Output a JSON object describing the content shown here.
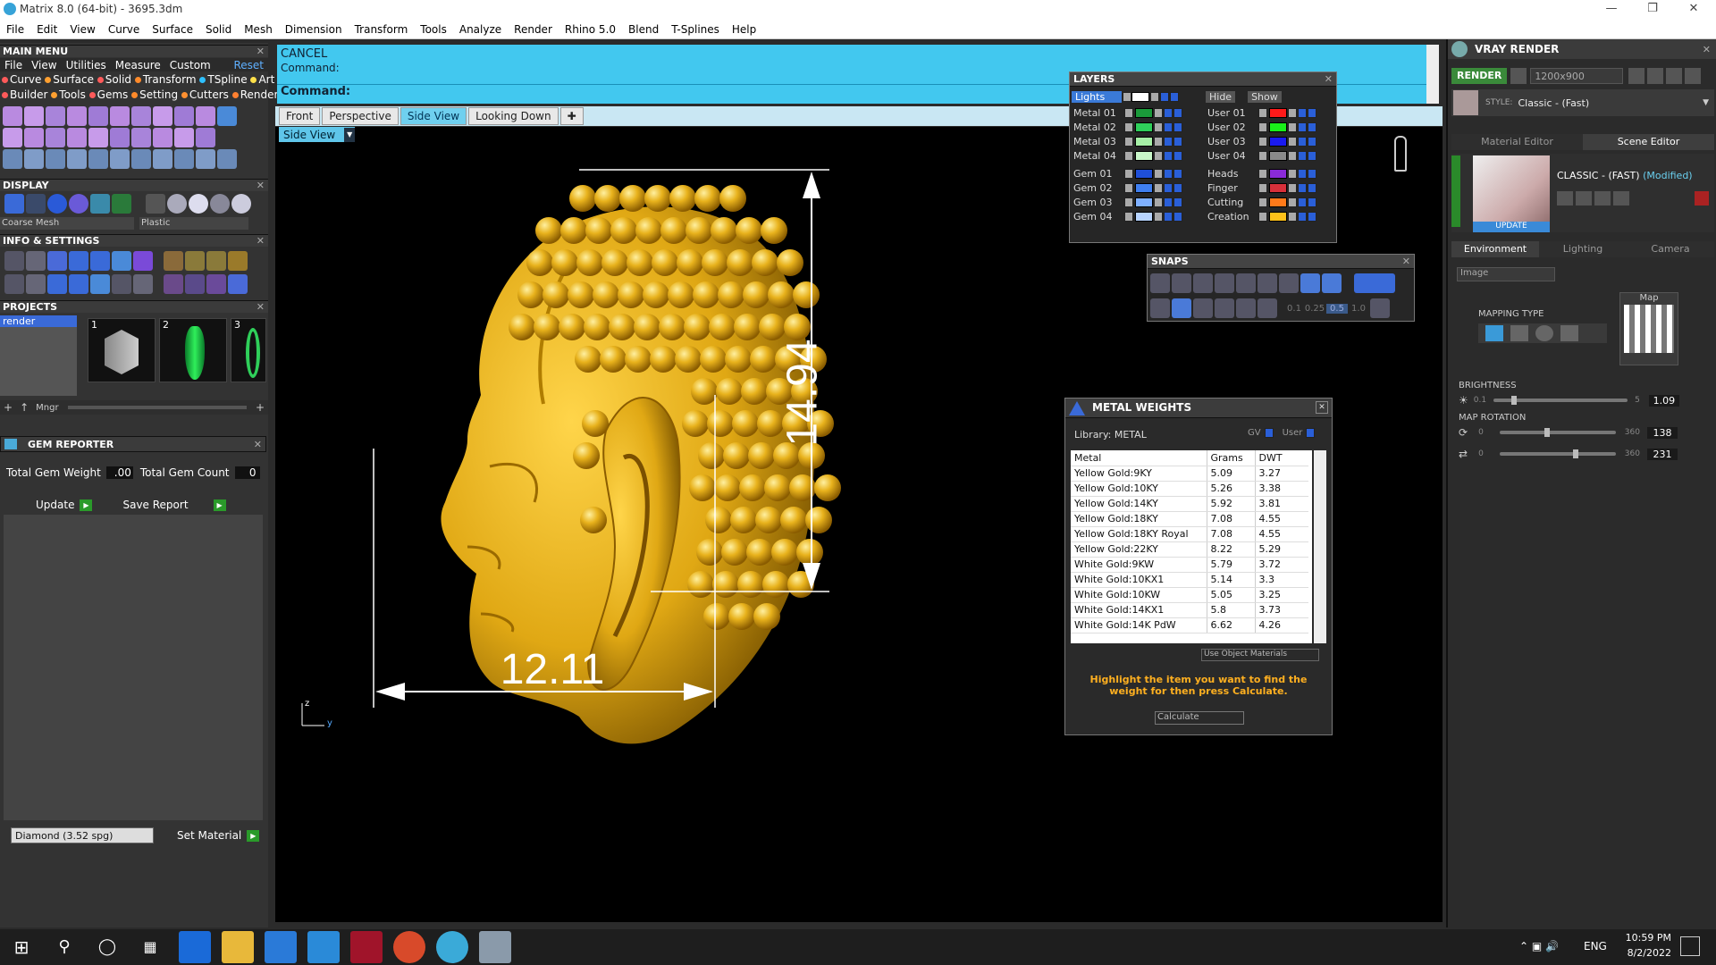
{
  "app": {
    "title": "Matrix 8.0 (64-bit) - 3695.3dm"
  },
  "menubar": [
    "File",
    "Edit",
    "View",
    "Curve",
    "Surface",
    "Solid",
    "Mesh",
    "Dimension",
    "Transform",
    "Tools",
    "Analyze",
    "Render",
    "Rhino 5.0",
    "Blend",
    "T-Splines",
    "Help"
  ],
  "main_menu": {
    "title": "MAIN MENU",
    "reset": "Reset",
    "menu": [
      "File",
      "View",
      "Utilities",
      "Measure",
      "Custom"
    ],
    "row1": [
      "Curve",
      "Surface",
      "Solid",
      "Transform",
      "TSpline",
      "Art"
    ],
    "row2": [
      "Builder",
      "Tools",
      "Gems",
      "Setting",
      "Cutters",
      "Render"
    ],
    "colors1": [
      "#ff5a5a",
      "#ffa030",
      "#ff5a5a",
      "#ff8a2a",
      "#2ec0ff",
      "#ffe04a"
    ],
    "colors2": [
      "#ff5a5a",
      "#ffa030",
      "#ff5a5a",
      "#ff8a2a",
      "#ff9030",
      "#ff8030"
    ]
  },
  "display": {
    "title": "DISPLAY",
    "mesh": "Coarse Mesh",
    "material": "Plastic"
  },
  "info": {
    "title": "INFO & SETTINGS"
  },
  "projects": {
    "title": "PROJECTS",
    "item": "render",
    "numbers": [
      "1",
      "2",
      "3"
    ],
    "mngr": "Mngr"
  },
  "gem_reporter": {
    "title": "GEM REPORTER",
    "weight_label": "Total Gem Weight",
    "weight_value": ".00",
    "count_label": "Total Gem Count",
    "count_value": "0",
    "update": "Update",
    "save": "Save Report",
    "gem_select": "Diamond   (3.52 spg)",
    "set_material": "Set Material"
  },
  "command": {
    "cancel": "CANCEL",
    "line1": "Command:",
    "line2": "Command:"
  },
  "view_tabs": [
    "Front",
    "Perspective",
    "Side View",
    "Looking Down"
  ],
  "view_active": "Side View",
  "view_label": "Side View",
  "dimensions": {
    "height": "14.94",
    "width": "12.11"
  },
  "axis": {
    "z": "z",
    "y": "y"
  },
  "layers": {
    "title": "LAYERS",
    "lights": "Lights",
    "hide": "Hide",
    "show": "Show",
    "left": [
      {
        "name": "Metal 01",
        "color": "#1a9a3a"
      },
      {
        "name": "Metal 02",
        "color": "#2fcf5a"
      },
      {
        "name": "Metal 03",
        "color": "#a6f0a6"
      },
      {
        "name": "Metal 04",
        "color": "#c9f7c9"
      },
      {
        "name": "Gem 01",
        "color": "#1f4fd8"
      },
      {
        "name": "Gem 02",
        "color": "#3f7ff0"
      },
      {
        "name": "Gem 03",
        "color": "#7fb0ff"
      },
      {
        "name": "Gem 04",
        "color": "#b8d4ff"
      }
    ],
    "right": [
      {
        "name": "User 01",
        "color": "#ff1a1a"
      },
      {
        "name": "User 02",
        "color": "#1aef1a"
      },
      {
        "name": "User 03",
        "color": "#1a1aef"
      },
      {
        "name": "User 04",
        "color": "#8a8a8a"
      },
      {
        "name": "Heads",
        "color": "#8a2ad8"
      },
      {
        "name": "Finger",
        "color": "#d8303a"
      },
      {
        "name": "Cutting",
        "color": "#ff7a1a"
      },
      {
        "name": "Creation",
        "color": "#ffc21a"
      }
    ]
  },
  "snaps": {
    "title": "SNAPS",
    "values": [
      "0.1",
      "0.25",
      "0.5",
      "1.0"
    ]
  },
  "metal_weights": {
    "title": "METAL WEIGHTS",
    "library": "Library: METAL",
    "gv": "GV",
    "user": "User",
    "headers": [
      "Metal",
      "Grams",
      "DWT"
    ],
    "rows": [
      [
        "Yellow Gold:9KY",
        "5.09",
        "3.27"
      ],
      [
        "Yellow Gold:10KY",
        "5.26",
        "3.38"
      ],
      [
        "Yellow Gold:14KY",
        "5.92",
        "3.81"
      ],
      [
        "Yellow Gold:18KY",
        "7.08",
        "4.55"
      ],
      [
        "Yellow Gold:18KY Royal",
        "7.08",
        "4.55"
      ],
      [
        "Yellow Gold:22KY",
        "8.22",
        "5.29"
      ],
      [
        "White Gold:9KW",
        "5.79",
        "3.72"
      ],
      [
        "White Gold:10KX1",
        "5.14",
        "3.3"
      ],
      [
        "White Gold:10KW",
        "5.05",
        "3.25"
      ],
      [
        "White Gold:14KX1",
        "5.8",
        "3.73"
      ],
      [
        "White Gold:14K PdW",
        "6.62",
        "4.26"
      ]
    ],
    "use_materials": "Use Object Materials",
    "hint": "Highlight the item you want to find the weight for then press Calculate.",
    "calculate": "Calculate"
  },
  "vray": {
    "title": "VRAY RENDER",
    "render": "RENDER",
    "resolution": "1200x900",
    "style_label": "STYLE:",
    "style_value": "Classic - (Fast)",
    "editor_tabs": [
      "Material Editor",
      "Scene Editor"
    ],
    "scene_name": "CLASSIC - (FAST)",
    "modified": "(Modified)",
    "update": "UPDATE",
    "env_tabs": [
      "Environment",
      "Lighting",
      "Camera"
    ],
    "env_select": "Image",
    "map_label": "Map",
    "mapping_type": "MAPPING TYPE",
    "brightness": "BRIGHTNESS",
    "brightness_min": "0.1",
    "brightness_max": "5",
    "brightness_value": "1.09",
    "map_rotation": "MAP ROTATION",
    "rot1_min": "0",
    "rot1_max": "360",
    "rot1_value": "138",
    "rot2_min": "0",
    "rot2_max": "360",
    "rot2_value": "231"
  },
  "taskbar": {
    "lang": "ENG",
    "time": "10:59 PM",
    "date": "8/2/2022"
  }
}
